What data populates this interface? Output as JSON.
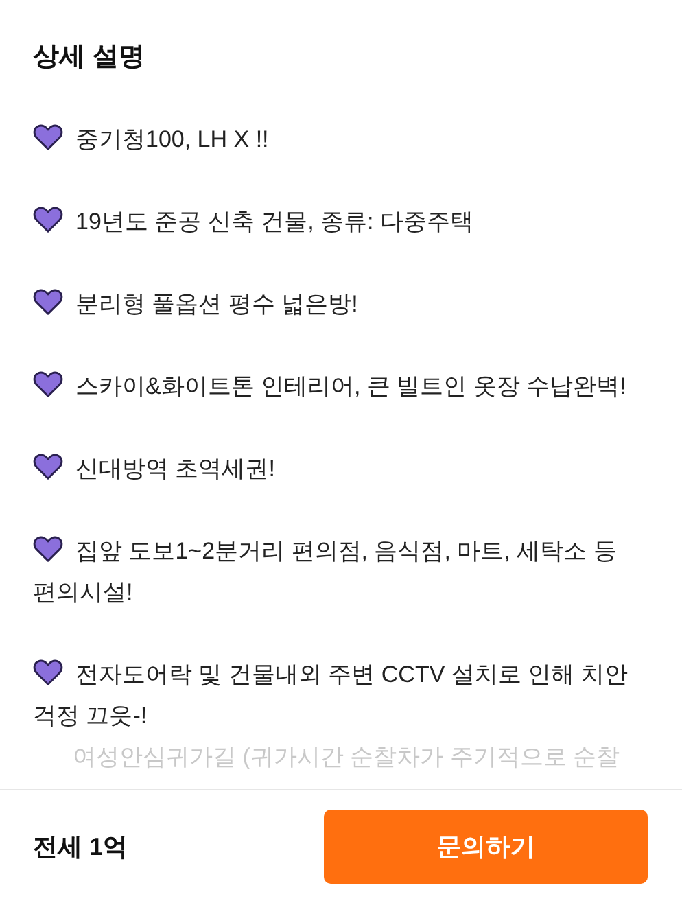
{
  "section": {
    "title": "상세 설명",
    "lines": [
      {
        "kind": "bullet",
        "text": "중기청100, LH X !!"
      },
      {
        "kind": "bullet",
        "text": "19년도 준공 신축 건물, 종류: 다중주택"
      },
      {
        "kind": "bullet",
        "text": "분리형 풀옵션 평수 넓은방!"
      },
      {
        "kind": "bullet",
        "text": "스카이&화이트톤 인테리어, 큰 빌트인 옷장 수납완벽!"
      },
      {
        "kind": "bullet",
        "text": "신대방역 초역세권!"
      },
      {
        "kind": "bullet",
        "text": "집앞 도보1~2분거리 편의점, 음식점, 마트, 세탁소 등 편의시설!"
      },
      {
        "kind": "bullet",
        "text": "전자도어락 및 건물내외 주변 CCTV 설치로 인해 치안 걱정 끄읏-!"
      },
      {
        "kind": "faded",
        "text": "여성안심귀가길 (귀가시간 순찰차가 주기적으로 순찰"
      }
    ]
  },
  "footer": {
    "price": "전세 1억",
    "button": "문의하기"
  }
}
